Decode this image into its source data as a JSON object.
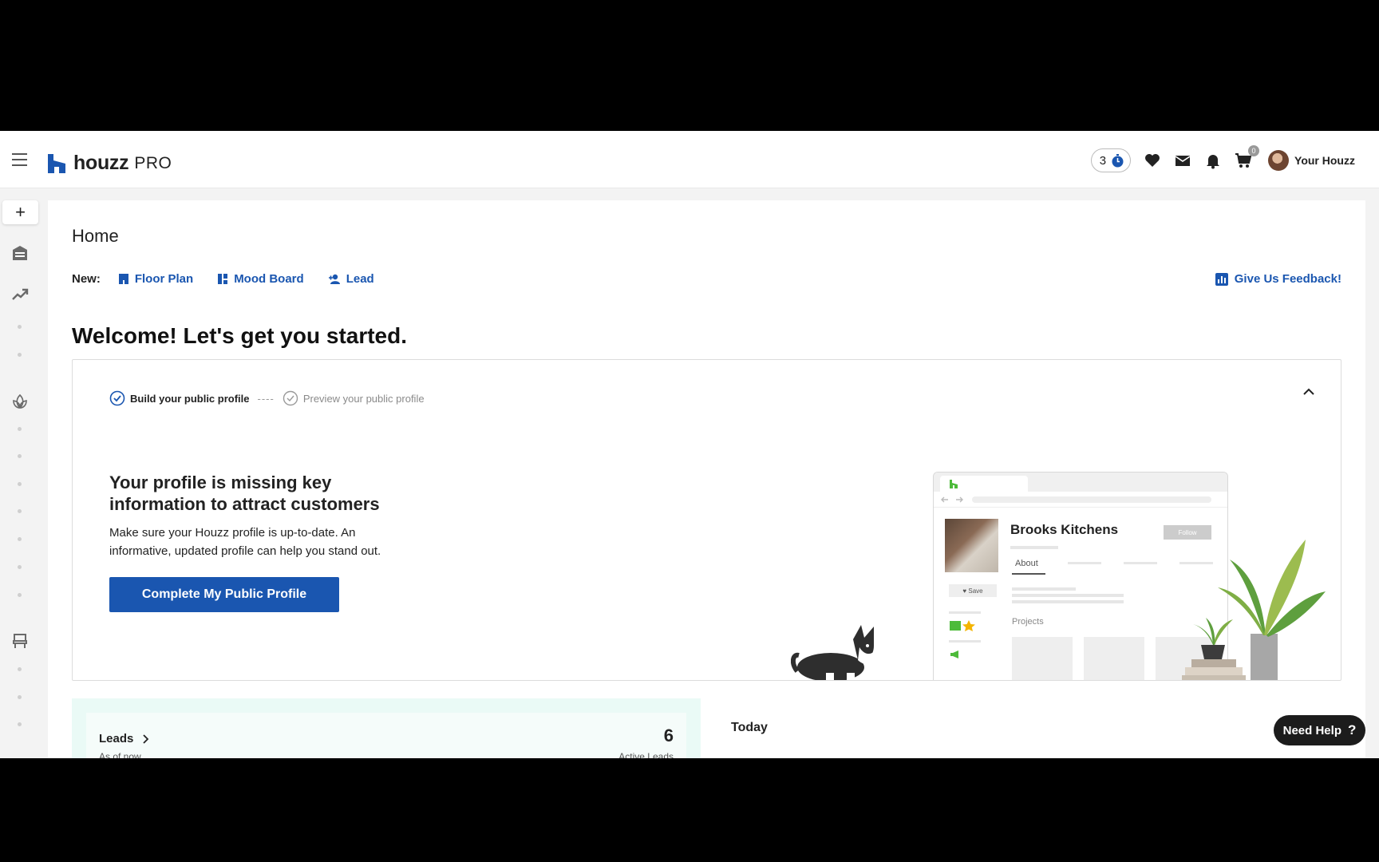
{
  "header": {
    "brand": "houzz",
    "brand_suffix": "PRO",
    "timer_count": "3",
    "cart_count": "0",
    "user_name": "Your Houzz"
  },
  "main": {
    "title": "Home",
    "new_label": "New:",
    "new_links": [
      "Floor Plan",
      "Mood Board",
      "Lead"
    ],
    "feedback_label": "Give Us Feedback!",
    "welcome": "Welcome! Let's get you started."
  },
  "profile_card": {
    "steps": [
      "Build your public profile",
      "Preview your public profile"
    ],
    "step_separator": "----",
    "heading": "Your profile is missing key information to attract customers",
    "description": "Make sure your Houzz profile is up-to-date. An informative, updated profile can help you stand out.",
    "cta_label": "Complete My Public Profile",
    "illustration": {
      "business_name": "Brooks Kitchens",
      "follow_label": "Follow",
      "tab_label": "About",
      "save_label": "♥ Save",
      "projects_label": "Projects"
    }
  },
  "leads_widget": {
    "title": "Leads",
    "subtitle": "As of now",
    "count": "6",
    "count_label": "Active Leads"
  },
  "today_widget": {
    "title": "Today"
  },
  "help_button": {
    "label": "Need Help",
    "icon": "?"
  },
  "colors": {
    "accent": "#1a56b0",
    "brand_green": "#4dbb3a",
    "leads_bg": "#eafaf6"
  }
}
